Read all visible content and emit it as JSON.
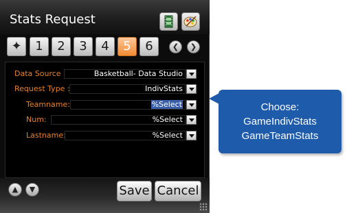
{
  "window": {
    "title": "Stats Request"
  },
  "toolbar": {
    "icons": [
      "film-icon",
      "palette-icon"
    ]
  },
  "tabs": {
    "items": [
      "1",
      "2",
      "3",
      "4",
      "5",
      "6"
    ],
    "active": "5",
    "star_glyph": "✦",
    "prev_glyph": "❮",
    "next_glyph": "❯"
  },
  "form": {
    "data_source": {
      "label": "Data Source :",
      "value": "Basketball- Data Studio"
    },
    "request_type": {
      "label": "Request Type :",
      "value": "IndivStats"
    },
    "teamname": {
      "label": "Teamname:",
      "value": "%Select"
    },
    "num": {
      "label": "Num:",
      "value": "%Select"
    },
    "lastname": {
      "label": "Lastname:",
      "value": "%Select"
    }
  },
  "footer": {
    "up_glyph": "▲",
    "down_glyph": "▼",
    "save_label": "Save",
    "cancel_label": "Cancel"
  },
  "callout": {
    "line1": "Choose:",
    "line2": "GameIndivStats",
    "line3": "GameTeamStats"
  },
  "colors": {
    "label": "#e8822a",
    "active_tab": "#f08a32",
    "callout": "#1e5bab",
    "selection": "#3a5fa8"
  }
}
